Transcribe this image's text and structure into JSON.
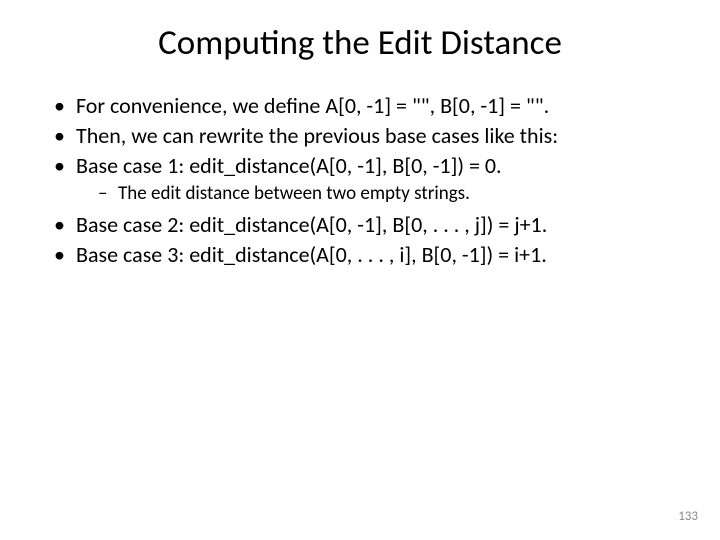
{
  "title": "Computing the Edit Distance",
  "bullets": {
    "b1": "For convenience, we define A[0, -1] = \"\", B[0, -1] = \"\".",
    "b2": "Then, we can rewrite the previous base cases like this:",
    "b3": "Base case 1: edit_distance(A[0, -1], B[0, -1])  = 0.",
    "b3sub": "The edit distance between two empty strings.",
    "b4": "Base case 2: edit_distance(A[0, -1], B[0, . . . , j])  = j+1.",
    "b5": "Base case 3: edit_distance(A[0, . . . , i], B[0, -1])  = i+1."
  },
  "page_number": "133"
}
